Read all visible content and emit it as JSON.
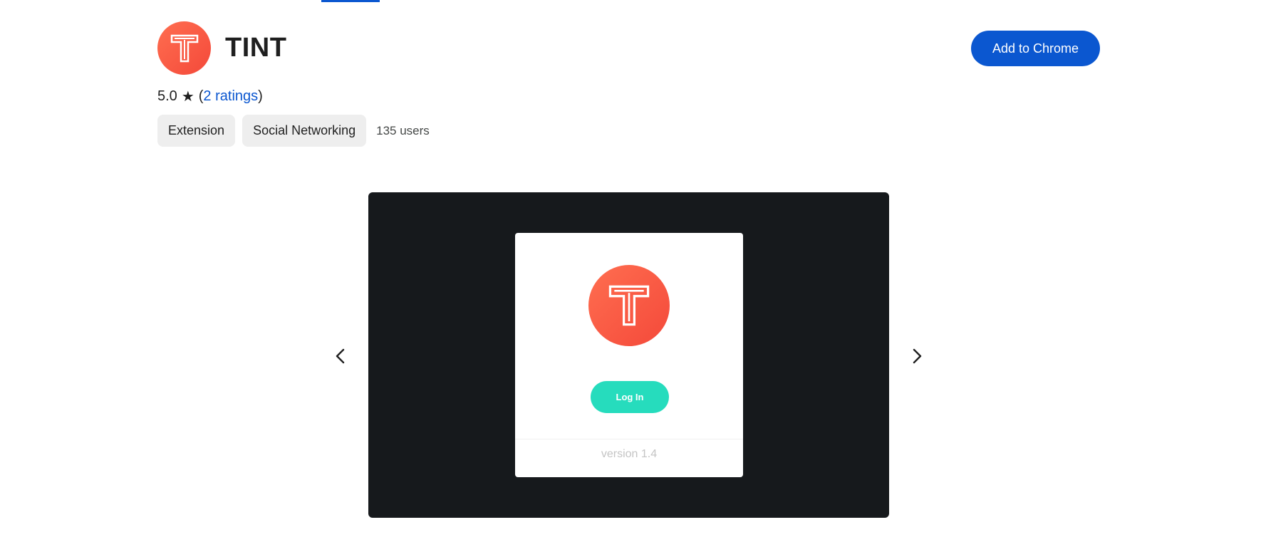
{
  "app": {
    "title": "TINT",
    "logo_icon": "tint-t-logo-icon",
    "brand_color": "#f4493a"
  },
  "header": {
    "add_button_label": "Add to Chrome",
    "accent_color": "#0b57d0"
  },
  "rating": {
    "score": "5.0",
    "star": "★",
    "open_paren": "(",
    "ratings_link": "2 ratings",
    "close_paren": ")"
  },
  "chips": [
    {
      "label": "Extension"
    },
    {
      "label": "Social Networking"
    }
  ],
  "users": "135 users",
  "carousel": {
    "prev_icon": "chevron-left-icon",
    "next_icon": "chevron-right-icon",
    "screenshot": {
      "login_label": "Log In",
      "login_color": "#26dcbd",
      "version": "version 1.4"
    }
  }
}
